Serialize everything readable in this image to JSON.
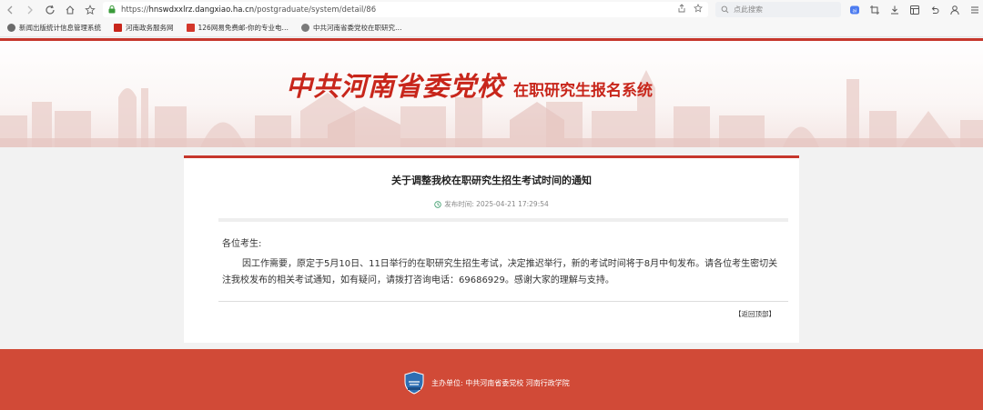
{
  "browser": {
    "url_prefix": "https://",
    "url_host": "hnswdxxlrz.dangxiao.ha.cn",
    "url_path": "/postgraduate/system/detail/86",
    "search_placeholder": "点此搜索",
    "bookmarks": [
      {
        "label": "新闻出版统计信息管理系统",
        "color": "#6b6b6b"
      },
      {
        "label": "河南政务服务网",
        "color": "#c8261b"
      },
      {
        "label": "126网易免费邮-你的专业电…",
        "color": "#d3372b"
      },
      {
        "label": "中共河南省委党校在职研究…",
        "color": "#7a7a7a"
      }
    ]
  },
  "banner": {
    "title_main": "中共河南省委党校",
    "title_sub": "在职研究生报名系统"
  },
  "article": {
    "title": "关于调整我校在职研究生招生考试时间的通知",
    "date_label": "发布时间: 2025-04-21 17:29:54",
    "greeting": "各位考生:",
    "paragraph": "因工作需要，原定于5月10日、11日举行的在职研究生招生考试，决定推迟举行，新的考试时间将于8月中旬发布。请各位考生密切关注我校发布的相关考试通知，如有疑问，请拨打咨询电话：69686929。感谢大家的理解与支持。",
    "back_to_top": "【返回顶部】"
  },
  "footer": {
    "host_text": "主办单位:  中共河南省委党校 河南行政学院"
  },
  "colors": {
    "brand_red": "#c8261b",
    "footer_red": "#d14a37"
  }
}
